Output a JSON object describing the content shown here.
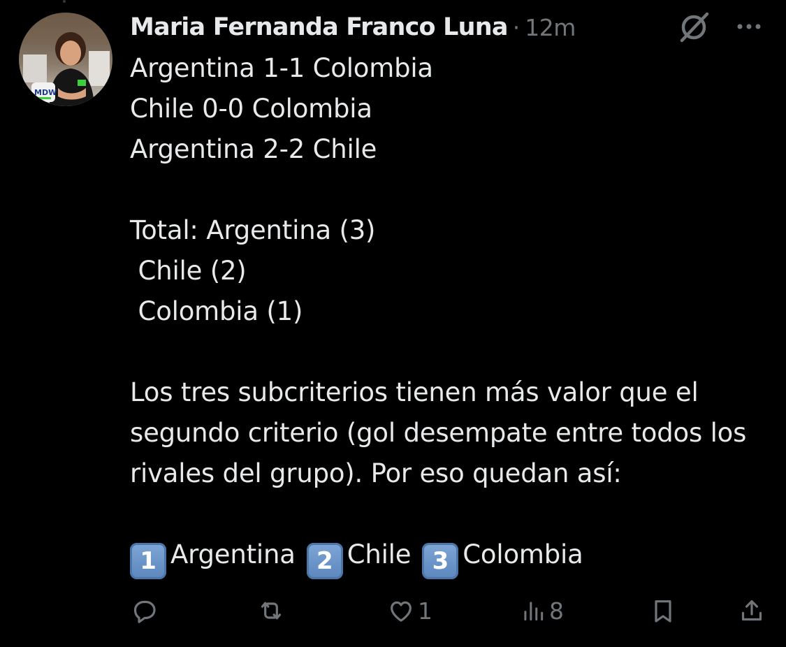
{
  "post": {
    "author": {
      "display_name": "Maria Fernanda Franco Luna",
      "avatar_icon": "profile-photo-icon"
    },
    "separator": "·",
    "timestamp": "12m",
    "body": {
      "scores": [
        "Argentina 1-1 Colombia",
        "Chile 0-0 Colombia",
        "Argentina 2-2 Chile"
      ],
      "totals": [
        "Total: Argentina (3)",
        " Chile (2)",
        " Colombia (1)"
      ],
      "paragraph": "Los tres subcriterios tienen más valor que el segundo criterio (gol desempate entre todos los rivales del grupo). Por eso quedan así:",
      "ranking": [
        {
          "badge": "1",
          "team": "Argentina"
        },
        {
          "badge": "2",
          "team": "Chile"
        },
        {
          "badge": "3",
          "team": "Colombia"
        }
      ]
    },
    "stats": {
      "replies": "",
      "reposts": "",
      "likes": "1",
      "views": "8"
    },
    "icons": {
      "grok": "grok-icon",
      "more": "more-icon",
      "reply": "reply-icon",
      "repost": "repost-icon",
      "like": "heart-icon",
      "views": "views-icon",
      "bookmark": "bookmark-icon",
      "share": "share-icon"
    },
    "colors": {
      "background": "#000000",
      "text": "#e7e9ea",
      "muted": "#71767b",
      "keycap": "#6a96cb"
    }
  }
}
